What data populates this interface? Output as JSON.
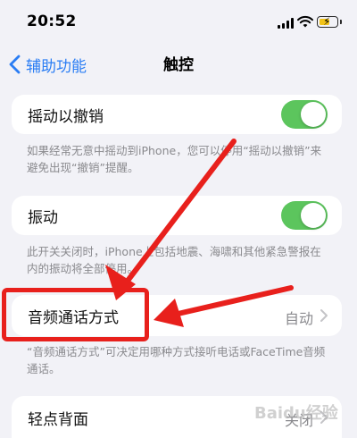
{
  "status_bar": {
    "time": "20:52"
  },
  "nav": {
    "back_label": "辅助功能",
    "title": "触控"
  },
  "shake_to_undo": {
    "label": "摇动以撤销",
    "enabled": true,
    "footer": "如果经常无意中摇动到iPhone，您可以停用“摇动以撤销”来避免出现“撤销”提醒。"
  },
  "vibration": {
    "label": "振动",
    "enabled": true,
    "footer": "此开关关闭时，iPhone上包括地震、海啸和其他紧急警报在内的振动将全部停用。"
  },
  "call_audio_routing": {
    "label": "音频通话方式",
    "value": "自动",
    "footer": "“音频通话方式”可决定用哪种方式接听电话或FaceTime音频通话。"
  },
  "back_tap": {
    "label": "轻点背面",
    "value": "关闭"
  },
  "watermark": "Baidu经验",
  "colors": {
    "accent": "#2a7df4",
    "toggle_on": "#5cc55d",
    "annotation": "#e8201c"
  }
}
